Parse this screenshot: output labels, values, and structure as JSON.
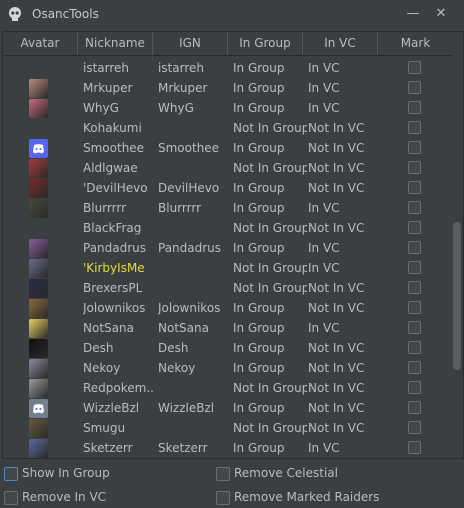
{
  "window": {
    "title": "OsancTools",
    "minimize_glyph": "—",
    "close_glyph": "✕",
    "icon": "skull-icon"
  },
  "colors": {
    "highlight_name": "#e6dc3a",
    "text": "#bbbbbb",
    "focus": "#4a88c7"
  },
  "table": {
    "columns": [
      "Avatar",
      "Nickname",
      "IGN",
      "In Group",
      "In VC",
      "Mark"
    ],
    "rows": [
      {
        "avatar": "none",
        "nickname": "istarreh",
        "ign": "istarreh",
        "in_group": "In Group",
        "in_vc": "In VC"
      },
      {
        "avatar": "#b98a7a",
        "nickname": "Mrkuper",
        "ign": "Mrkuper",
        "in_group": "In Group",
        "in_vc": "In VC"
      },
      {
        "avatar": "#c86a7a",
        "nickname": "WhyG",
        "ign": "WhyG",
        "in_group": "In Group",
        "in_vc": "In VC"
      },
      {
        "avatar": "none",
        "nickname": "Kohakumi",
        "ign": "",
        "in_group": "Not In Group",
        "in_vc": "Not In VC"
      },
      {
        "avatar": "discord",
        "nickname": "Smoothee",
        "ign": "Smoothee",
        "in_group": "In Group",
        "in_vc": "Not In VC"
      },
      {
        "avatar": "#a83a3a",
        "nickname": "Aldlgwae",
        "ign": "",
        "in_group": "Not In Group",
        "in_vc": "Not In VC"
      },
      {
        "avatar": "#7a2a2a",
        "nickname": "'DevilHevo",
        "ign": "DevilHevo",
        "in_group": "In Group",
        "in_vc": "Not In VC"
      },
      {
        "avatar": "#4a4a3a",
        "nickname": "Blurrrrr",
        "ign": "Blurrrrr",
        "in_group": "In Group",
        "in_vc": "In VC"
      },
      {
        "avatar": "none",
        "nickname": "BlackFrag",
        "ign": "",
        "in_group": "Not In Group",
        "in_vc": "Not In VC"
      },
      {
        "avatar": "#8a5aa0",
        "nickname": "Pandadrus",
        "ign": "Pandadrus",
        "in_group": "In Group",
        "in_vc": "In VC"
      },
      {
        "avatar": "#6a6a8a",
        "nickname": "'KirbyIsMe",
        "ign": "",
        "in_group": "Not In Group",
        "in_vc": "In VC",
        "highlight": true
      },
      {
        "avatar": "#2a2a4a",
        "nickname": "BrexersPL",
        "ign": "",
        "in_group": "Not In Group",
        "in_vc": "Not In VC"
      },
      {
        "avatar": "#8a6a3a",
        "nickname": "Jolownikos",
        "ign": "Jolownikos",
        "in_group": "In Group",
        "in_vc": "Not In VC"
      },
      {
        "avatar": "#e8d060",
        "nickname": "NotSana",
        "ign": "NotSana",
        "in_group": "In Group",
        "in_vc": "In VC"
      },
      {
        "avatar": "#111111",
        "nickname": "Desh",
        "ign": "Desh",
        "in_group": "In Group",
        "in_vc": "Not In VC"
      },
      {
        "avatar": "#8a8aa0",
        "nickname": "Nekoy",
        "ign": "Nekoy",
        "in_group": "In Group",
        "in_vc": "Not In VC"
      },
      {
        "avatar": "#9a9a9a",
        "nickname": "Redpokem...",
        "ign": "",
        "in_group": "Not In Group",
        "in_vc": "Not In VC"
      },
      {
        "avatar": "discord-gray",
        "nickname": "WizzleBzl",
        "ign": "WizzleBzl",
        "in_group": "In Group",
        "in_vc": "Not In VC"
      },
      {
        "avatar": "#6a5a3a",
        "nickname": "Smugu",
        "ign": "",
        "in_group": "Not In Group",
        "in_vc": "Not In VC"
      },
      {
        "avatar": "#5a6aa0",
        "nickname": "Sketzerr",
        "ign": "Sketzerr",
        "in_group": "In Group",
        "in_vc": "In VC"
      }
    ]
  },
  "options": {
    "show_in_group": "Show In Group",
    "remove_in_vc": "Remove In VC",
    "remove_celestial": "Remove Celestial",
    "remove_marked_raiders": "Remove Marked Raiders"
  }
}
